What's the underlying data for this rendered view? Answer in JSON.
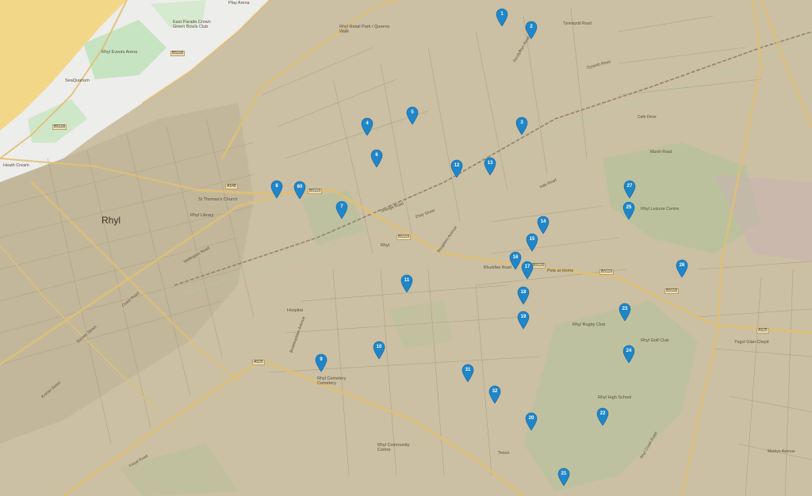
{
  "map": {
    "town_label": "Rhyl",
    "poi_labels": {
      "play_arena": "Play Arena",
      "bowls_club": "East Parade Crown Green Bowls Club",
      "events_arena": "Rhyl Events Arena",
      "sealquarium": "SeaQuarium",
      "queens_walk": "Rhyl Retail Park / Queens Walk",
      "heath_creamery": "Heath Cream",
      "rhyl_library": "Rhyl Library",
      "st_thomas": "St Thomas's Church",
      "rhyl_station": "Rhyl",
      "hospital": "Hospital",
      "rhyl_cemetery": "Rhyl Cemetery Cemetery",
      "rhyl_leisure": "Rhyl Leisure Centre",
      "rhyl_golf": "Rhyl Golf Club",
      "glan_clwyd": "Ysgol Glan Clwyd",
      "rhuddlan_rd": "Pets at Home",
      "rhyl_rugby": "Rhyl Rugby Club",
      "tesco": "Tesco",
      "rhyl_school": "Rhyl High School",
      "community": "Rhyl Community Centre"
    },
    "road_labels": {
      "grange_road": "Grange Road",
      "rhuddlan_road": "Rhuddlan Road",
      "dyserth_road": "Dyserth Road",
      "pendyffryn_road": "Pendyffryn Road",
      "tynewydd_road": "Tynewydd Road",
      "marsh_road": "Marsh Road",
      "elwy_street": "Elwy Street",
      "vale_road": "Vale Road",
      "boughton_ave": "Boughton Avenue",
      "cefn_drive": "Cefn Drive",
      "wellington_road": "Wellington Road",
      "coast_road": "Coast Road",
      "bodelwyddan_ave": "Bodelwyddan Avenue",
      "foryd_road": "Foryd Road",
      "rhyl_coast_road": "Rhyl Coast Road",
      "kinmel_street": "Kinmel Street",
      "sussex_street": "Sussex Street",
      "madryn_ave": "Madryn Avenue"
    },
    "road_shields": {
      "b5118_a": "B5118",
      "b5118_b": "B5118",
      "a525": "A525",
      "a548": "A548",
      "b5119_a": "B5119",
      "b5119_b": "B5119",
      "b5120": "B5120",
      "b5118_c": "B5118",
      "b5119_c": "B5119",
      "a525_b": "A525"
    },
    "markers": [
      "1",
      "2",
      "3",
      "4",
      "5",
      "6",
      "7",
      "8",
      "9",
      "10",
      "11",
      "12",
      "13",
      "14",
      "15",
      "16",
      "17",
      "18",
      "19",
      "20",
      "21",
      "22",
      "23",
      "24",
      "25",
      "26",
      "27",
      "31",
      "32",
      "60"
    ],
    "colors": {
      "sea": "#f3d789",
      "land_historic": "#cbbfa4",
      "marker": "#1f86c9",
      "road_main": "#e0c074",
      "green": "#b5c29a"
    }
  }
}
